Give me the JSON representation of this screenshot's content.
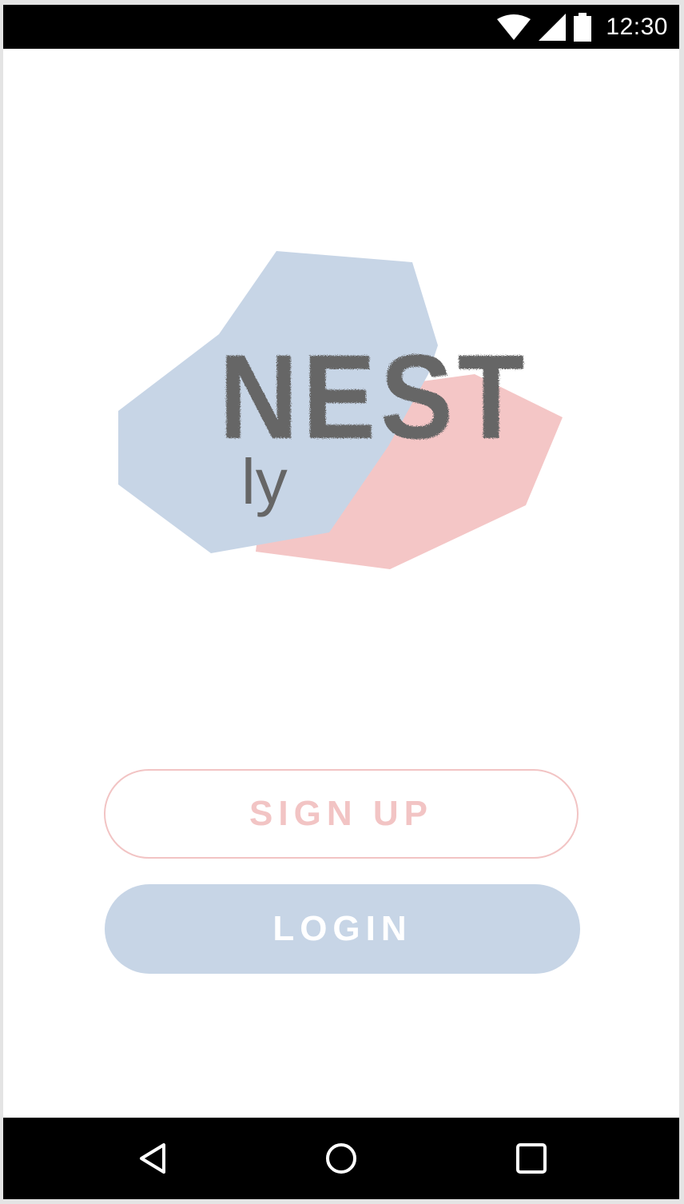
{
  "status_bar": {
    "time": "12:30",
    "icons": [
      "wifi-icon",
      "cell-signal-icon",
      "battery-icon"
    ]
  },
  "logo": {
    "wordmark": "NEST",
    "suffix": "ly",
    "colors": {
      "blue_shape": "#c7d5e6",
      "pink_shape": "#f4c6c6",
      "text": "#666666"
    }
  },
  "actions": {
    "signup_label": "SIGN UP",
    "login_label": "LOGIN"
  },
  "nav_bar": {
    "icons": [
      "back-icon",
      "home-icon",
      "recents-icon"
    ]
  },
  "colors": {
    "accent_pink": "#f2c4c4",
    "accent_blue": "#c7d5e6"
  }
}
